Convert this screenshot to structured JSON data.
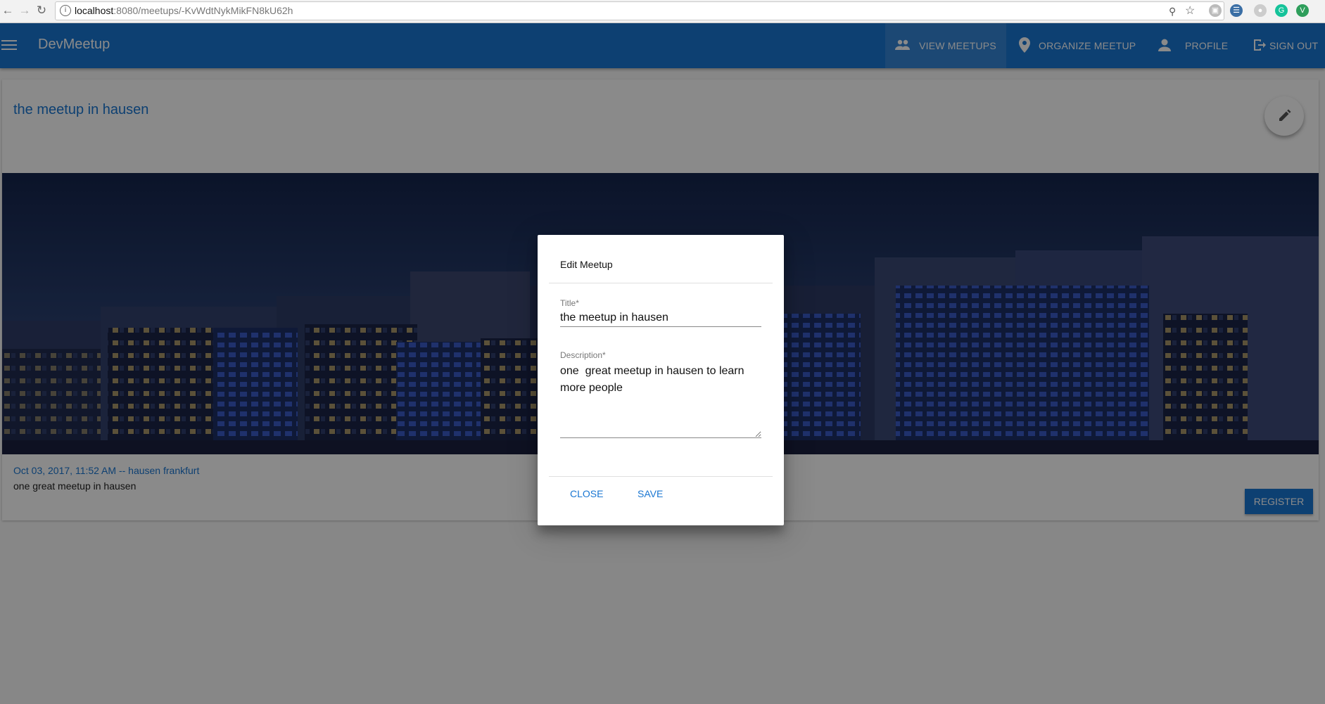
{
  "browser": {
    "url_host": "localhost",
    "url_path": ":8080/meetups/-KvWdtNykMikFN8kU62h"
  },
  "toolbar": {
    "app_title": "DevMeetup",
    "nav": [
      {
        "label": "View Meetups",
        "icon": "people-icon"
      },
      {
        "label": "Organize Meetup",
        "icon": "location-pin-icon"
      },
      {
        "label": "Profile",
        "icon": "person-icon"
      },
      {
        "label": "Sign out",
        "icon": "exit-icon"
      }
    ]
  },
  "meetup": {
    "title": "the meetup in hausen",
    "meta": "Oct 03, 2017, 11:52 AM -- hausen frankfurt",
    "description": "one great meetup in hausen",
    "register_label": "Register"
  },
  "dialog": {
    "title": "Edit Meetup",
    "title_label": "Title*",
    "title_value": "the meetup in hausen",
    "description_label": "Description*",
    "description_value": "one  great meetup in hausen to learn more people",
    "close_label": "Close",
    "save_label": "Save"
  },
  "colors": {
    "primary": "#1976d2",
    "overlay": "rgba(0,0,0,0.46)"
  }
}
